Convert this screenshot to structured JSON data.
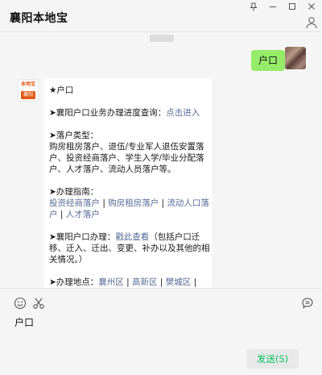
{
  "window": {
    "title": "襄阳本地宝",
    "controls": [
      "pin-icon",
      "minimize-icon",
      "maximize-icon",
      "close-icon"
    ]
  },
  "chat": {
    "timestamp": "",
    "my_message": "户口",
    "bot_avatar": {
      "logo_top": "本地宝",
      "logo_bottom": "襄阳"
    },
    "bot_message": {
      "heading": "★户口",
      "progress": {
        "prefix": "➤襄阳户口业务办理进度查询：",
        "link": "点击进入"
      },
      "types_title": "➤落户类型：",
      "types_lines": [
        "购房租房落户、退伍/专业军人退伍安置落",
        "户、投资经商落户、学生入学/毕业分配落",
        "户、人才落户、流动人员落户等。"
      ],
      "guide_title": "➤办理指南：",
      "guide_links": [
        "投资经商落户",
        "购房租房落户",
        "流动人口落",
        "户",
        "人才落户"
      ],
      "apply_prefix": "➤襄阳户口办理：",
      "apply_link": "戳此查看",
      "apply_suffix": "（包括户口迁",
      "apply_lines": [
        "移、迁入、迁出、变更、补办以及其他的相",
        "关情况。）"
      ],
      "location_prefix": "➤办理地点：",
      "location_links": [
        "襄州区",
        "高新区",
        "樊城区"
      ]
    }
  },
  "toolbar": {
    "icons": [
      "emoji-icon",
      "scissors-icon",
      "chat-bubble-icon"
    ]
  },
  "input": {
    "value": "户口"
  },
  "send_button": {
    "label": "发送(S)"
  },
  "colors": {
    "accent_green": "#07c160",
    "my_bubble": "#95ec69",
    "link": "#576b95",
    "brand_orange": "#e35b16"
  }
}
